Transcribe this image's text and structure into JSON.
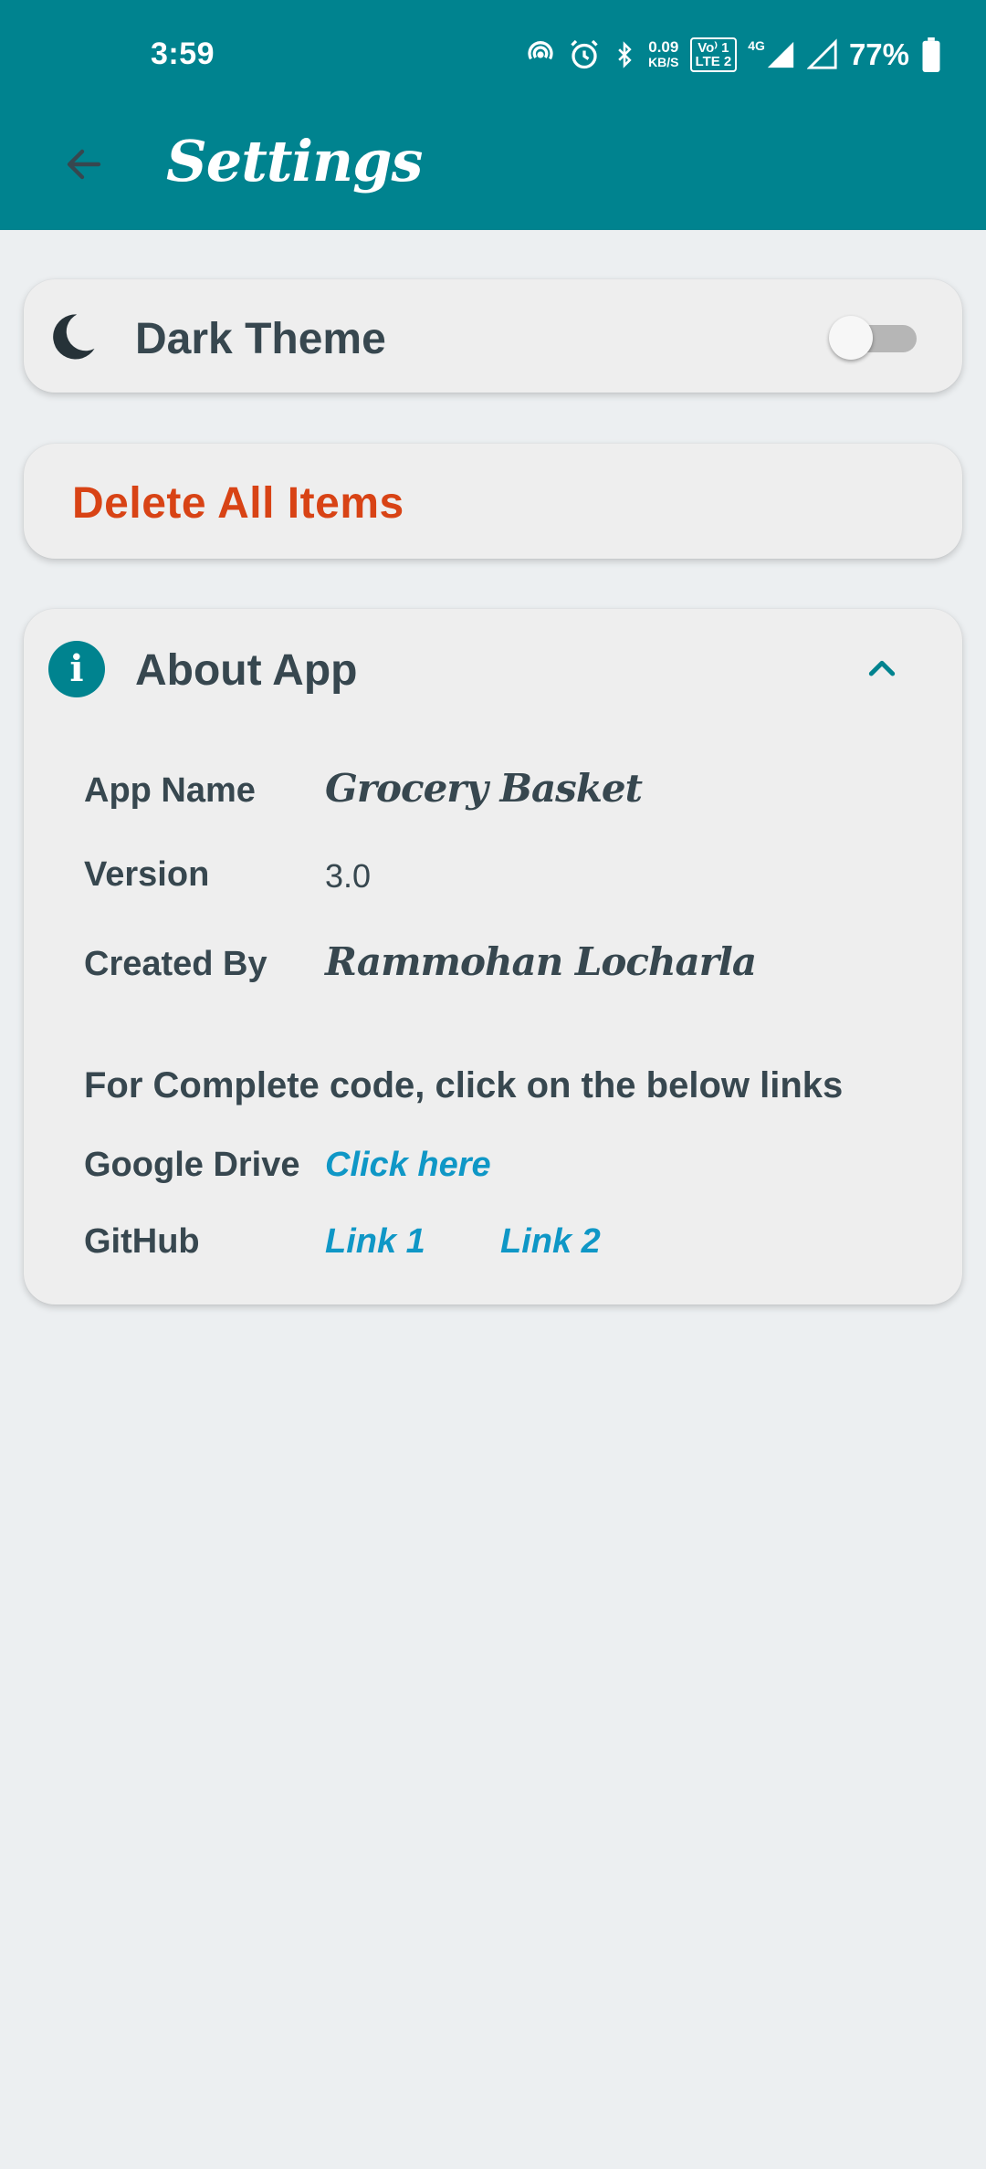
{
  "status_bar": {
    "time": "3:59",
    "net_speed_value": "0.09",
    "net_speed_unit": "KB/S",
    "volte_top": "Vo⁾ 1",
    "volte_bottom": "LTE 2",
    "network": "4G",
    "battery": "77%"
  },
  "app_bar": {
    "title": "Settings",
    "back_icon": "arrow-left-icon"
  },
  "dark_theme": {
    "label": "Dark Theme",
    "icon": "moon-icon",
    "enabled": false
  },
  "delete": {
    "label": "Delete All Items",
    "color": "#d84315"
  },
  "about": {
    "title": "About App",
    "icon": "info-icon",
    "expanded": true,
    "app_name_label": "App Name",
    "app_name_value": "Grocery Basket",
    "version_label": "Version",
    "version_value": "3.0",
    "created_by_label": "Created By",
    "created_by_value": "Rammohan Locharla",
    "code_heading": "For Complete code, click on the below links",
    "google_drive_label": "Google Drive",
    "google_drive_link": "Click here",
    "github_label": "GitHub",
    "github_link1": "Link 1",
    "github_link2": "Link 2"
  },
  "colors": {
    "primary": "#00838f",
    "background": "#eceff1",
    "card": "#eeeeee",
    "text": "#37474f",
    "link": "#0f97c6"
  }
}
